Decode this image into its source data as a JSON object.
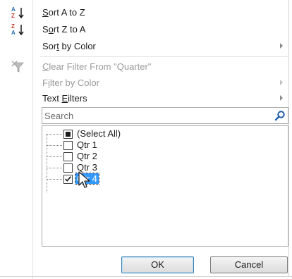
{
  "menu": {
    "sort_az": {
      "label_pre": "",
      "label_key": "S",
      "label_post": "ort A to Z",
      "icon": "sort-ascending-icon"
    },
    "sort_za": {
      "label_pre": "S",
      "label_key": "o",
      "label_post": "rt Z to A",
      "icon": "sort-descending-icon"
    },
    "sort_by_color": {
      "label_pre": "Sor",
      "label_key": "t",
      "label_post": " by Color",
      "enabled": true
    },
    "clear_filter": {
      "label_pre": "",
      "label_key": "C",
      "label_post": "lear Filter From \"Quarter\"",
      "icon": "clear-filter-icon",
      "enabled": false
    },
    "filter_by_color": {
      "label_pre": "F",
      "label_key": "i",
      "label_post": "lter by Color",
      "enabled": false
    },
    "text_filters": {
      "label_pre": "Text ",
      "label_key": "E",
      "label_post": "ilters",
      "enabled": true
    }
  },
  "search": {
    "placeholder": "Search",
    "icon": "search-icon"
  },
  "list": {
    "items": [
      {
        "label": "(Select All)",
        "state": "mixed"
      },
      {
        "label": "Qtr 1",
        "state": "unchecked"
      },
      {
        "label": "Qtr 2",
        "state": "unchecked"
      },
      {
        "label": "Qtr 3",
        "state": "unchecked"
      },
      {
        "label": "Qtr 4",
        "state": "checked",
        "selected": true
      }
    ]
  },
  "buttons": {
    "ok": "OK",
    "cancel": "Cancel"
  },
  "colors": {
    "selection": "#3399ff",
    "ok_border": "#3c7fb1",
    "search_icon": "#1f5fa6"
  }
}
